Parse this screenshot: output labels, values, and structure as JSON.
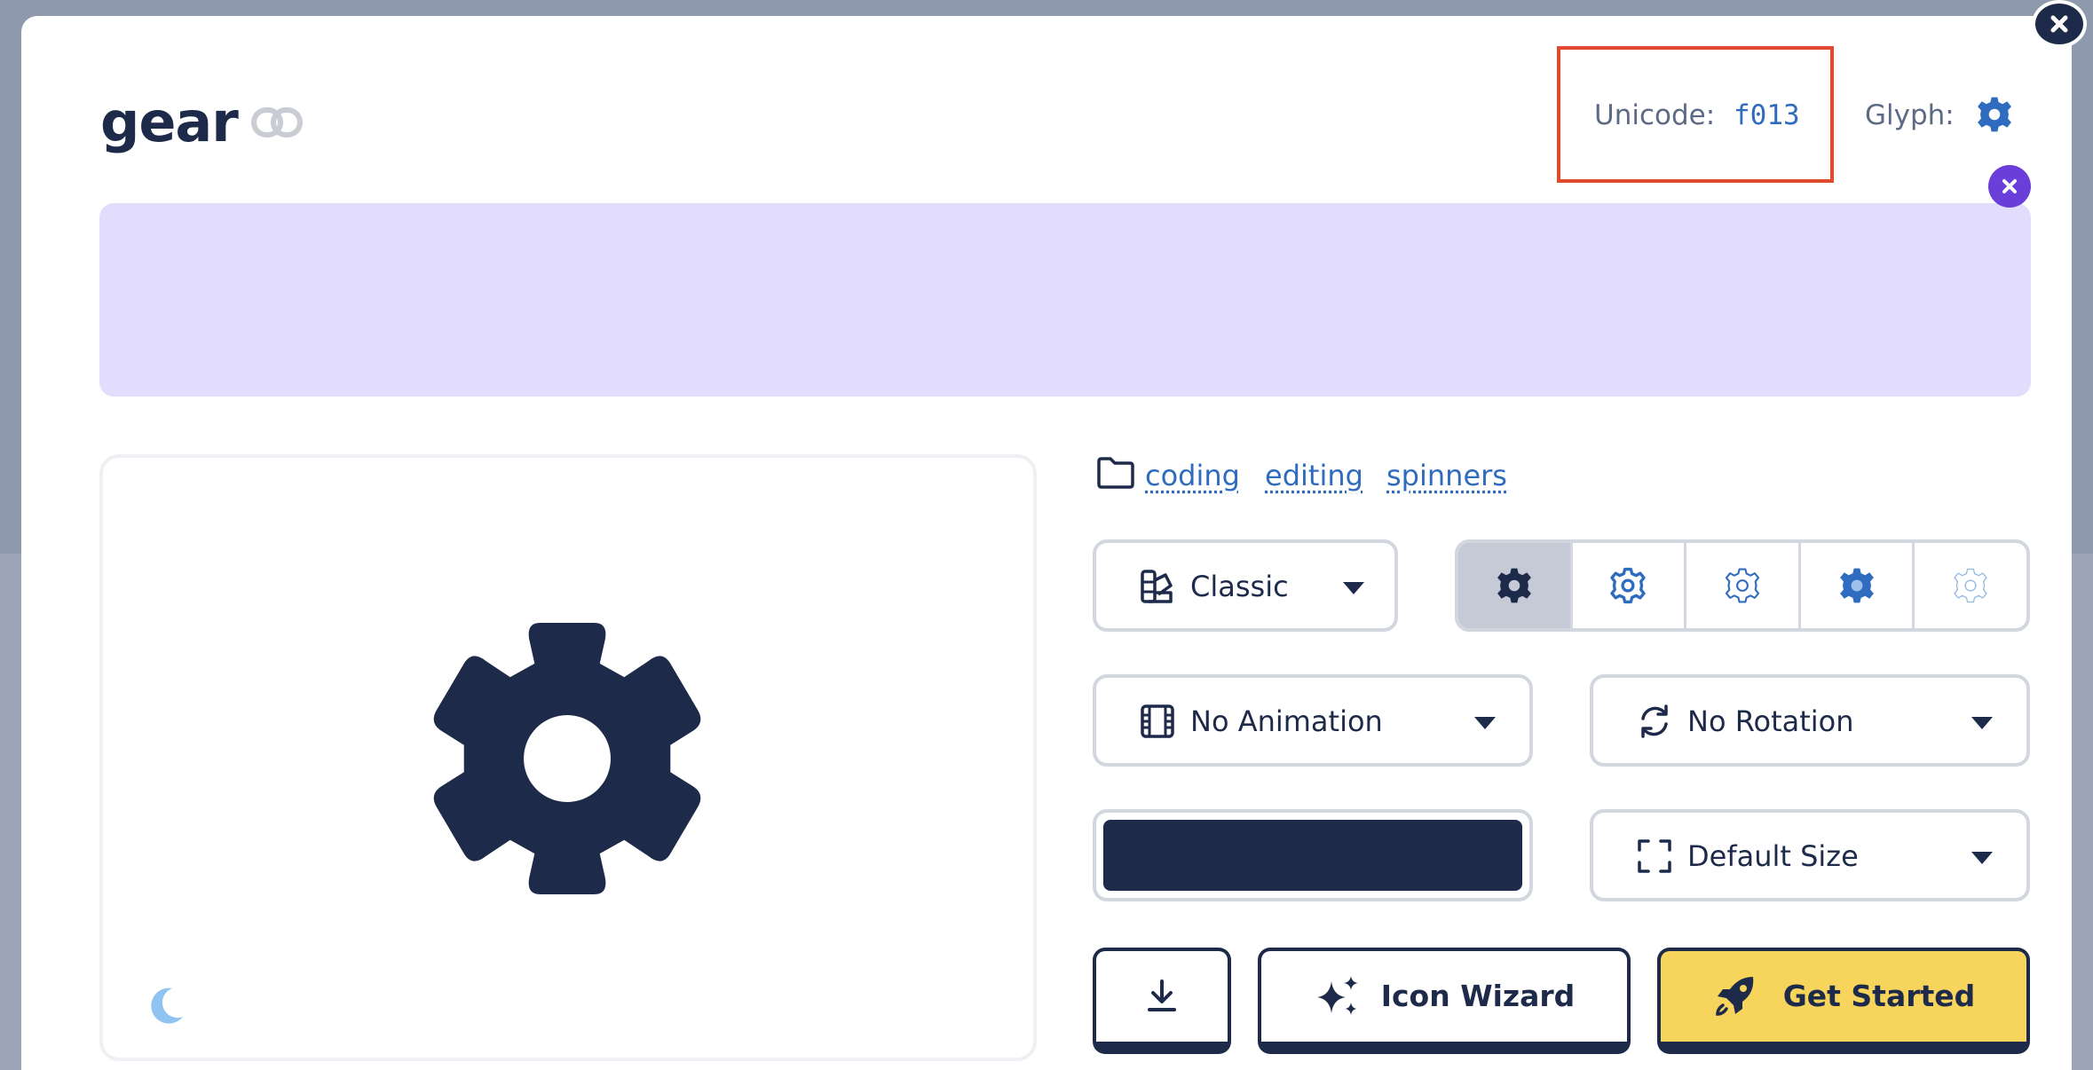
{
  "icon": {
    "name": "gear",
    "unicode_label": "Unicode:",
    "unicode_value": "f013",
    "glyph_label": "Glyph:"
  },
  "categories": [
    "coding",
    "editing",
    "spinners"
  ],
  "controls": {
    "style_family": "Classic",
    "animation": "No Animation",
    "rotation": "No Rotation",
    "size": "Default Size",
    "color": "#1e2a4a",
    "style_variants": [
      "solid-gear-icon",
      "regular-gear-icon",
      "light-gear-icon",
      "duotone-gear-icon",
      "thin-gear-icon"
    ],
    "active_variant": 0
  },
  "buttons": {
    "download": "download-icon",
    "wizard_label": "Icon Wizard",
    "get_started_label": "Get Started"
  },
  "colors": {
    "primary": "#1e2a4a",
    "link": "#2f6cc0",
    "highlight_box": "#e04a2f",
    "banner": "#e2ddfc",
    "cta_yellow": "#f7d55c"
  }
}
